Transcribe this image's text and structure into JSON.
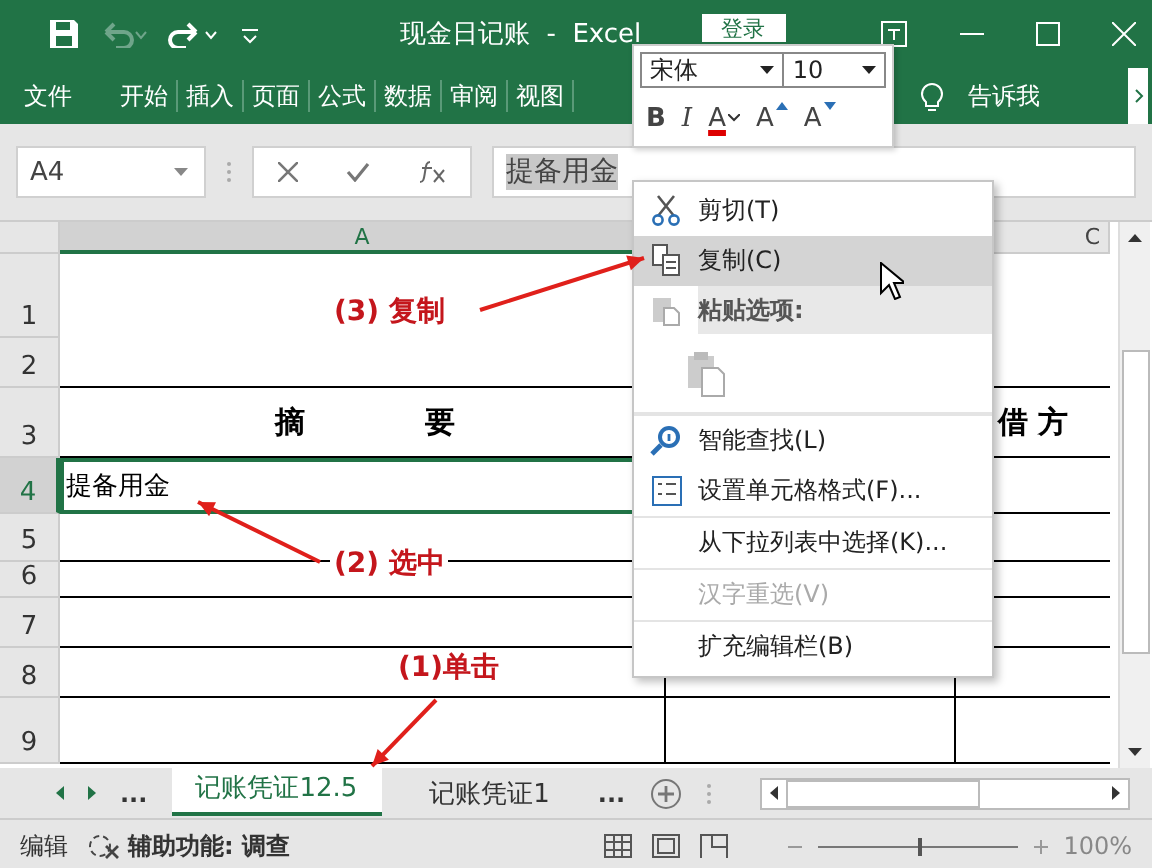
{
  "window": {
    "title": "现金日记账  -  Excel",
    "sign_in": "登录"
  },
  "ribbon": {
    "tabs": [
      {
        "label": "文件"
      },
      {
        "label": "开始"
      },
      {
        "label": "插入"
      },
      {
        "label": "页面"
      },
      {
        "label": "公式"
      },
      {
        "label": "数据"
      },
      {
        "label": "审阅"
      },
      {
        "label": "视图"
      }
    ],
    "tell_me": "告诉我"
  },
  "mini_toolbar": {
    "font": "宋体",
    "size": "10",
    "buttons": [
      {
        "kind": "bold",
        "label": "B"
      },
      {
        "kind": "italic",
        "label": "I"
      },
      {
        "kind": "color",
        "label": "A"
      },
      {
        "kind": "grow",
        "label": "A"
      },
      {
        "kind": "shrink",
        "label": "A"
      }
    ]
  },
  "formula_bar": {
    "name_box": "A4",
    "value": "提备用金"
  },
  "sheet": {
    "columns": [
      {
        "label": "A"
      },
      {
        "label": "C"
      }
    ],
    "rows": [
      {
        "number": "1",
        "selected": false
      },
      {
        "number": "2",
        "selected": false
      },
      {
        "number": "3",
        "selected": false,
        "col_a": "摘　　　　要",
        "col_c": "借 方"
      },
      {
        "number": "4",
        "selected": true,
        "col_a": "提备用金"
      },
      {
        "number": "5",
        "selected": false
      },
      {
        "number": "6",
        "selected": false
      },
      {
        "number": "7",
        "selected": false
      },
      {
        "number": "8",
        "selected": false
      },
      {
        "number": "9",
        "selected": false
      }
    ]
  },
  "context_menu": [
    {
      "kind": "item",
      "label": "剪切(T)",
      "selected": false,
      "disabled": false
    },
    {
      "kind": "item",
      "label": "复制(C)",
      "selected": true,
      "disabled": false
    },
    {
      "kind": "header",
      "label": "粘贴选项:"
    },
    {
      "kind": "paste"
    },
    {
      "kind": "item",
      "label": "智能查找(L)",
      "selected": false,
      "disabled": false
    },
    {
      "kind": "item",
      "label": "设置单元格格式(F)...",
      "selected": false,
      "disabled": false
    },
    {
      "kind": "item",
      "label": "从下拉列表中选择(K)...",
      "selected": false,
      "disabled": false
    },
    {
      "kind": "item",
      "label": "汉字重选(V)",
      "selected": false,
      "disabled": true
    },
    {
      "kind": "item",
      "label": "扩充编辑栏(B)",
      "selected": false,
      "disabled": false
    }
  ],
  "sheet_tabs": {
    "more_left": "...",
    "tabs": [
      {
        "label": "记账凭证12.5",
        "selected": true
      },
      {
        "label": "记账凭证1",
        "selected": false
      }
    ],
    "more_right": "..."
  },
  "status_bar": {
    "mode": "编辑",
    "accessibility": "辅助功能: 调查",
    "zoom": "100%",
    "zoom_level": {
      "level": 0.5
    }
  },
  "annotations": [
    {
      "label": "(3) 复制"
    },
    {
      "label": "(2) 选中"
    },
    {
      "label": "(1)单击"
    }
  ]
}
